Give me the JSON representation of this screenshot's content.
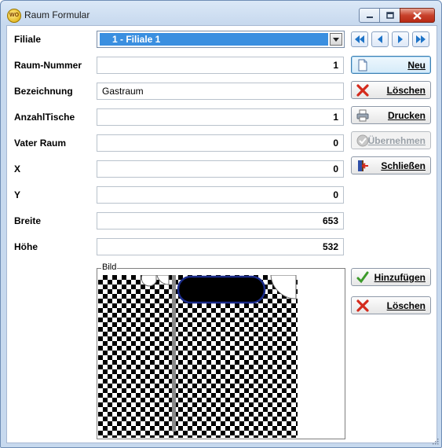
{
  "window": {
    "title": "Raum Formular",
    "app_icon_text": "WO",
    "buttons": [
      "minimize-icon",
      "maximize-icon",
      "close-icon"
    ]
  },
  "form": {
    "filiale_label": "Filiale",
    "filiale_value": "1 - Filiale 1",
    "raum_nummer_label": "Raum-Nummer",
    "raum_nummer_value": "1",
    "bezeichnung_label": "Bezeichnung",
    "bezeichnung_value": "Gastraum",
    "anzahl_tische_label": "AnzahlTische",
    "anzahl_tische_value": "1",
    "vater_raum_label": "Vater Raum",
    "vater_raum_value": "0",
    "x_label": "X",
    "x_value": "0",
    "y_label": "Y",
    "y_value": "0",
    "breite_label": "Breite",
    "breite_value": "653",
    "hoehe_label": "Höhe",
    "hoehe_value": "532",
    "bild_label": "Bild"
  },
  "nav_buttons": [
    "first-record-icon",
    "previous-record-icon",
    "next-record-icon",
    "last-record-icon"
  ],
  "actions": {
    "neu": "Neu",
    "loeschen": "Löschen",
    "drucken": "Drucken",
    "uebernehmen": "Übernehmen",
    "schliessen": "Schließen",
    "hinzufuegen": "Hinzufügen",
    "bild_loeschen": "Löschen"
  },
  "colors": {
    "accent": "#3a8fe0",
    "selection_text": "#ffffff",
    "disabled_text": "#9aa1a8",
    "danger": "#d42a1c",
    "ok": "#3c9a2a"
  }
}
